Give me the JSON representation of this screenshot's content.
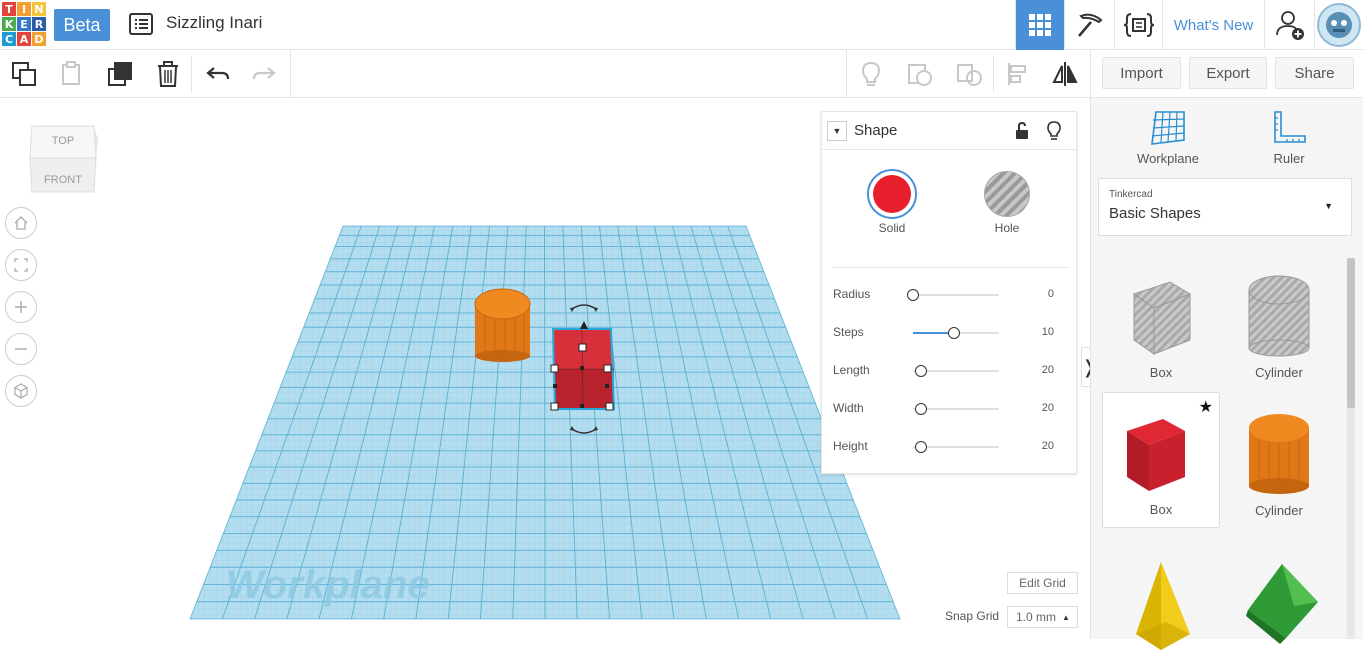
{
  "app": {
    "logo_letters": [
      "T",
      "I",
      "N",
      "K",
      "E",
      "R",
      "C",
      "A",
      "D"
    ],
    "logo_colors": [
      "#e2433a",
      "#f4a031",
      "#f6c33b",
      "#4cac4f",
      "#3478c6",
      "#2d5ca6",
      "#1e9ad6",
      "#e2433a",
      "#f4a031"
    ],
    "beta_label": "Beta",
    "project_title": "Sizzling Inari",
    "whats_new": "What's New",
    "accent": "#4a90d9"
  },
  "toolbar": {
    "import": "Import",
    "export": "Export",
    "share": "Share"
  },
  "viewcube": {
    "top": "TOP",
    "front": "FRONT"
  },
  "workplane_watermark": "Workplane",
  "shape_panel": {
    "title": "Shape",
    "solid": "Solid",
    "hole": "Hole",
    "solid_color": "#e8202e",
    "properties": [
      {
        "label": "Radius",
        "value": "0",
        "fraction": 0.0
      },
      {
        "label": "Steps",
        "value": "10",
        "fraction": 0.45
      },
      {
        "label": "Length",
        "value": "20",
        "fraction": 0.08
      },
      {
        "label": "Width",
        "value": "20",
        "fraction": 0.08
      },
      {
        "label": "Height",
        "value": "20",
        "fraction": 0.08
      }
    ]
  },
  "right_panel": {
    "workplane": "Workplane",
    "ruler": "Ruler",
    "category_small": "Tinkercad",
    "category": "Basic Shapes",
    "shapes": [
      {
        "label": "Box"
      },
      {
        "label": "Cylinder"
      },
      {
        "label": "Box"
      },
      {
        "label": "Cylinder"
      }
    ]
  },
  "bottom": {
    "edit_grid": "Edit Grid",
    "snap_grid_label": "Snap Grid",
    "snap_grid_value": "1.0 mm"
  }
}
